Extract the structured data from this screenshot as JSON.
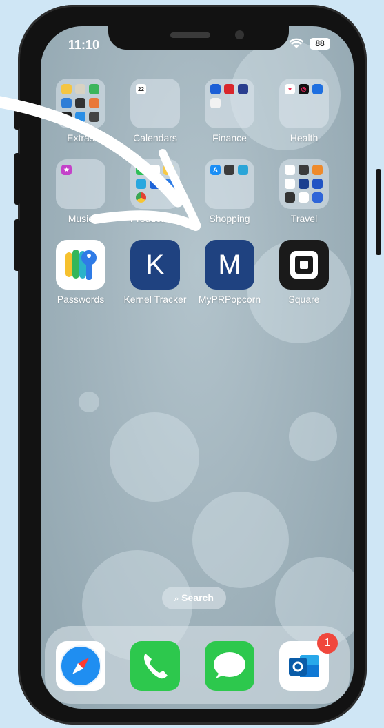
{
  "status_bar": {
    "time": "11:10",
    "battery": "88"
  },
  "apps_row1": [
    {
      "label": "Extras"
    },
    {
      "label": "Calendars",
      "calendar_day": "22"
    },
    {
      "label": "Finance"
    },
    {
      "label": "Health"
    }
  ],
  "apps_row2": [
    {
      "label": "Music"
    },
    {
      "label": "Productivity"
    },
    {
      "label": "Shopping"
    },
    {
      "label": "Travel"
    }
  ],
  "apps_row3": [
    {
      "label": "Passwords"
    },
    {
      "label": "Kernel Tracker",
      "letter": "K"
    },
    {
      "label": "MyPRPopcorn",
      "letter": "M"
    },
    {
      "label": "Square"
    }
  ],
  "search": {
    "label": "Search"
  },
  "dock": [
    {
      "name": "Safari"
    },
    {
      "name": "Phone"
    },
    {
      "name": "Messages"
    },
    {
      "name": "Outlook",
      "badge": "1"
    }
  ],
  "colors": {
    "background": "#cfe6f5",
    "kernel_icon": "#1f4280",
    "badge": "#f0473c"
  }
}
